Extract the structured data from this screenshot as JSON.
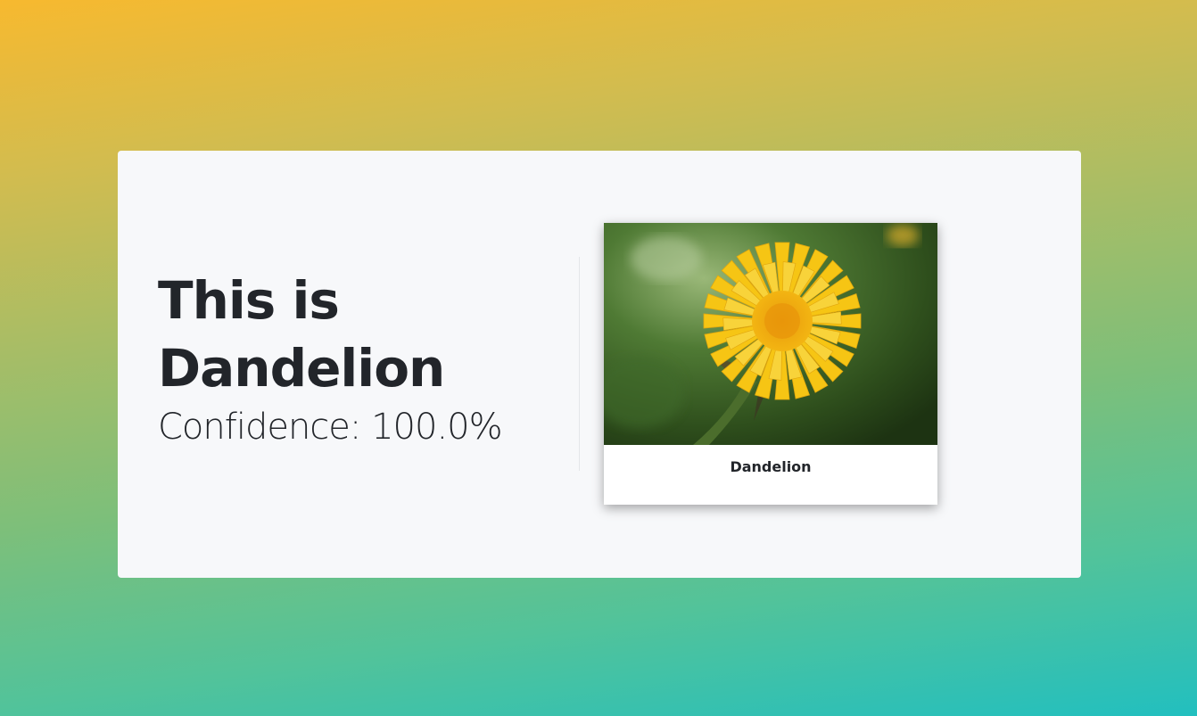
{
  "result": {
    "title": "This is Dandelion",
    "confidence_text": "Confidence: 100.0%"
  },
  "image_card": {
    "caption": "Dandelion"
  },
  "colors": {
    "panel_bg": "#f7f8fa",
    "text": "#22252a",
    "gradient_top": "#f7b92f",
    "gradient_bottom": "#22bfbf",
    "flower_yellow": "#f6c514"
  }
}
